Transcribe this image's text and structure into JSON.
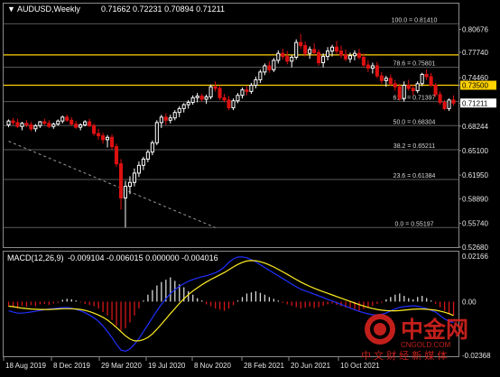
{
  "chart_data": [
    {
      "type": "candlestick",
      "title": "AUDUSD,Weekly",
      "ohlc_label": "0.71662 0.72231 0.70894 0.71211",
      "ylim": [
        0.5268,
        0.84
      ],
      "y_ticks": [
        "0.80676",
        "0.77740",
        "0.74460",
        "0.73500",
        "0.71211",
        "0.68244",
        "0.65100",
        "0.61950",
        "0.58890",
        "0.55740",
        "0.52680"
      ],
      "x_labels": [
        "18 Aug 2019",
        "8 Dec 2019",
        "29 Mar 2020",
        "19 Jul 2020",
        "8 Nov 2020",
        "28 Feb 2021",
        "20 Jun 2021",
        "10 Oct 2021"
      ],
      "fib_levels": [
        {
          "label": "100.0 = 0.81410",
          "value": 0.8141
        },
        {
          "label": "78.6 = 0.75801",
          "value": 0.75801
        },
        {
          "label": "61.8 = 0.71397",
          "value": 0.71397
        },
        {
          "label": "50.0 = 0.68304",
          "value": 0.68304
        },
        {
          "label": "38.2 = 0.65211",
          "value": 0.65211
        },
        {
          "label": "23.6 = 0.61384",
          "value": 0.61384
        },
        {
          "label": "0.0 = 0.55197",
          "value": 0.55197
        }
      ],
      "horizontal_lines": [
        {
          "value": 0.774,
          "label": "0.77400"
        },
        {
          "value": 0.735,
          "label": "0.73500"
        }
      ],
      "current_price": {
        "value": 0.71211,
        "label": "0.71211"
      },
      "candles": [
        [
          0.684,
          0.691,
          0.681,
          0.689
        ],
        [
          0.689,
          0.693,
          0.684,
          0.687
        ],
        [
          0.687,
          0.692,
          0.68,
          0.682
        ],
        [
          0.682,
          0.688,
          0.677,
          0.686
        ],
        [
          0.686,
          0.69,
          0.681,
          0.684
        ],
        [
          0.684,
          0.688,
          0.676,
          0.679
        ],
        [
          0.679,
          0.685,
          0.675,
          0.683
        ],
        [
          0.683,
          0.689,
          0.68,
          0.688
        ],
        [
          0.688,
          0.692,
          0.684,
          0.686
        ],
        [
          0.686,
          0.69,
          0.68,
          0.682
        ],
        [
          0.682,
          0.687,
          0.679,
          0.685
        ],
        [
          0.685,
          0.691,
          0.683,
          0.689
        ],
        [
          0.689,
          0.696,
          0.686,
          0.694
        ],
        [
          0.694,
          0.697,
          0.688,
          0.69
        ],
        [
          0.69,
          0.694,
          0.683,
          0.685
        ],
        [
          0.685,
          0.689,
          0.679,
          0.681
        ],
        [
          0.681,
          0.686,
          0.677,
          0.684
        ],
        [
          0.684,
          0.69,
          0.682,
          0.688
        ],
        [
          0.688,
          0.692,
          0.681,
          0.683
        ],
        [
          0.683,
          0.686,
          0.67,
          0.673
        ],
        [
          0.673,
          0.679,
          0.665,
          0.67
        ],
        [
          0.67,
          0.674,
          0.66,
          0.665
        ],
        [
          0.665,
          0.671,
          0.655,
          0.668
        ],
        [
          0.668,
          0.672,
          0.652,
          0.656
        ],
        [
          0.656,
          0.66,
          0.63,
          0.634
        ],
        [
          0.634,
          0.64,
          0.575,
          0.59
        ],
        [
          0.59,
          0.612,
          0.552,
          0.605
        ],
        [
          0.605,
          0.618,
          0.595,
          0.61
        ],
        [
          0.61,
          0.628,
          0.605,
          0.622
        ],
        [
          0.622,
          0.637,
          0.617,
          0.632
        ],
        [
          0.632,
          0.643,
          0.626,
          0.64
        ],
        [
          0.64,
          0.652,
          0.636,
          0.649
        ],
        [
          0.649,
          0.664,
          0.645,
          0.661
        ],
        [
          0.661,
          0.69,
          0.658,
          0.687
        ],
        [
          0.687,
          0.697,
          0.68,
          0.694
        ],
        [
          0.694,
          0.699,
          0.684,
          0.69
        ],
        [
          0.69,
          0.697,
          0.686,
          0.693
        ],
        [
          0.693,
          0.703,
          0.69,
          0.7
        ],
        [
          0.7,
          0.708,
          0.694,
          0.705
        ],
        [
          0.705,
          0.712,
          0.7,
          0.71
        ],
        [
          0.71,
          0.716,
          0.705,
          0.713
        ],
        [
          0.713,
          0.722,
          0.71,
          0.719
        ],
        [
          0.719,
          0.725,
          0.713,
          0.721
        ],
        [
          0.721,
          0.724,
          0.714,
          0.717
        ],
        [
          0.717,
          0.723,
          0.711,
          0.72
        ],
        [
          0.72,
          0.736,
          0.717,
          0.733
        ],
        [
          0.733,
          0.74,
          0.727,
          0.731
        ],
        [
          0.731,
          0.735,
          0.716,
          0.719
        ],
        [
          0.719,
          0.724,
          0.713,
          0.716
        ],
        [
          0.716,
          0.721,
          0.703,
          0.706
        ],
        [
          0.706,
          0.718,
          0.703,
          0.715
        ],
        [
          0.715,
          0.725,
          0.712,
          0.722
        ],
        [
          0.722,
          0.732,
          0.718,
          0.729
        ],
        [
          0.729,
          0.734,
          0.722,
          0.727
        ],
        [
          0.727,
          0.738,
          0.724,
          0.735
        ],
        [
          0.735,
          0.746,
          0.731,
          0.742
        ],
        [
          0.742,
          0.755,
          0.738,
          0.752
        ],
        [
          0.752,
          0.763,
          0.748,
          0.76
        ],
        [
          0.76,
          0.766,
          0.751,
          0.755
        ],
        [
          0.755,
          0.77,
          0.752,
          0.767
        ],
        [
          0.767,
          0.78,
          0.763,
          0.776
        ],
        [
          0.776,
          0.782,
          0.768,
          0.772
        ],
        [
          0.772,
          0.779,
          0.762,
          0.766
        ],
        [
          0.766,
          0.774,
          0.758,
          0.771
        ],
        [
          0.771,
          0.794,
          0.768,
          0.79
        ],
        [
          0.79,
          0.801,
          0.782,
          0.786
        ],
        [
          0.786,
          0.791,
          0.772,
          0.776
        ],
        [
          0.776,
          0.785,
          0.769,
          0.781
        ],
        [
          0.781,
          0.789,
          0.774,
          0.777
        ],
        [
          0.777,
          0.781,
          0.76,
          0.764
        ],
        [
          0.764,
          0.776,
          0.758,
          0.772
        ],
        [
          0.772,
          0.784,
          0.767,
          0.779
        ],
        [
          0.779,
          0.787,
          0.772,
          0.784
        ],
        [
          0.784,
          0.792,
          0.775,
          0.779
        ],
        [
          0.779,
          0.786,
          0.77,
          0.774
        ],
        [
          0.774,
          0.781,
          0.766,
          0.769
        ],
        [
          0.769,
          0.777,
          0.764,
          0.773
        ],
        [
          0.773,
          0.78,
          0.767,
          0.776
        ],
        [
          0.776,
          0.782,
          0.768,
          0.771
        ],
        [
          0.771,
          0.776,
          0.758,
          0.761
        ],
        [
          0.761,
          0.767,
          0.752,
          0.757
        ],
        [
          0.757,
          0.764,
          0.75,
          0.76
        ],
        [
          0.76,
          0.765,
          0.744,
          0.747
        ],
        [
          0.747,
          0.752,
          0.737,
          0.741
        ],
        [
          0.741,
          0.747,
          0.733,
          0.744
        ],
        [
          0.744,
          0.749,
          0.734,
          0.737
        ],
        [
          0.737,
          0.742,
          0.728,
          0.733
        ],
        [
          0.733,
          0.737,
          0.715,
          0.718
        ],
        [
          0.718,
          0.74,
          0.714,
          0.735
        ],
        [
          0.735,
          0.742,
          0.728,
          0.731
        ],
        [
          0.731,
          0.736,
          0.722,
          0.728
        ],
        [
          0.728,
          0.74,
          0.725,
          0.737
        ],
        [
          0.737,
          0.751,
          0.734,
          0.749
        ],
        [
          0.749,
          0.755,
          0.742,
          0.746
        ],
        [
          0.746,
          0.751,
          0.733,
          0.735
        ],
        [
          0.735,
          0.738,
          0.72,
          0.723
        ],
        [
          0.723,
          0.727,
          0.71,
          0.713
        ],
        [
          0.713,
          0.716,
          0.703,
          0.705
        ],
        [
          0.705,
          0.718,
          0.702,
          0.716
        ],
        [
          0.716,
          0.722,
          0.709,
          0.712
        ]
      ],
      "trend_line": [
        [
          0,
          0.663
        ],
        [
          46,
          0.552
        ]
      ]
    },
    {
      "type": "macd",
      "title": "MACD(12,26,9)",
      "values_label": "-0.009104 -0.006015 0.000000 -0.004016",
      "ylim": [
        -0.02368,
        0.02166
      ],
      "y_ticks": [
        "0.02166",
        "0.00",
        "-0.02368"
      ],
      "histogram": [
        -0.002,
        -0.0025,
        -0.003,
        -0.0018,
        -0.0022,
        -0.0015,
        -0.002,
        -0.0012,
        -0.001,
        -0.0014,
        -0.0008,
        -0.0005,
        0.0008,
        0.0012,
        0.001,
        0.0005,
        -0.0004,
        -0.001,
        -0.0015,
        -0.002,
        -0.003,
        -0.0045,
        -0.006,
        -0.008,
        -0.0105,
        -0.0125,
        -0.0115,
        -0.009,
        -0.006,
        -0.003,
        0.0005,
        0.003,
        0.005,
        0.007,
        0.0085,
        0.0095,
        0.0105,
        0.009,
        0.0075,
        0.0062,
        0.0045,
        0.003,
        0.0015,
        0.0005,
        -0.0012,
        -0.002,
        -0.003,
        -0.0035,
        -0.004,
        -0.003,
        -0.0015,
        0.0005,
        0.002,
        0.0035,
        0.004,
        0.0045,
        0.0038,
        0.003,
        0.002,
        0.0012,
        0.0005,
        -0.0005,
        -0.0012,
        -0.0018,
        -0.0024,
        -0.003,
        -0.0026,
        -0.0022,
        -0.0028,
        -0.0024,
        -0.0018,
        -0.0012,
        -0.0008,
        -0.0014,
        -0.002,
        -0.0026,
        -0.003,
        -0.0035,
        -0.004,
        -0.0032,
        -0.0025,
        -0.0018,
        -0.001,
        -0.0005,
        0.001,
        0.002,
        0.003,
        0.0035,
        0.0025,
        0.0015,
        0.001,
        0.002,
        0.0025,
        0.0015,
        0.0005,
        -0.001,
        -0.0025,
        -0.004,
        -0.0055,
        -0.006
      ],
      "macd_line": [
        -0.004,
        -0.0045,
        -0.005,
        -0.005,
        -0.0048,
        -0.0045,
        -0.0042,
        -0.0038,
        -0.0035,
        -0.0032,
        -0.003,
        -0.0028,
        -0.0026,
        -0.0025,
        -0.0028,
        -0.0034,
        -0.004,
        -0.0048,
        -0.0058,
        -0.007,
        -0.0085,
        -0.0105,
        -0.013,
        -0.0155,
        -0.0185,
        -0.021,
        -0.0215,
        -0.0205,
        -0.0185,
        -0.016,
        -0.013,
        -0.01,
        -0.007,
        -0.004,
        -0.0012,
        0.0012,
        0.0035,
        0.0052,
        0.0066,
        0.0078,
        0.0088,
        0.0096,
        0.0102,
        0.0108,
        0.0112,
        0.0118,
        0.0125,
        0.0135,
        0.015,
        0.017,
        0.0185,
        0.0193,
        0.0194,
        0.019,
        0.0182,
        0.0172,
        0.016,
        0.0148,
        0.0136,
        0.0124,
        0.0112,
        0.01,
        0.0088,
        0.0076,
        0.0064,
        0.0054,
        0.0046,
        0.004,
        0.0032,
        0.0025,
        0.0018,
        0.001,
        0.0003,
        -0.0005,
        -0.0012,
        -0.002,
        -0.0028,
        -0.0035,
        -0.0042,
        -0.0048,
        -0.0053,
        -0.0057,
        -0.0058,
        -0.0055,
        -0.005,
        -0.004,
        -0.0032,
        -0.0025,
        -0.0022,
        -0.002,
        -0.0018,
        -0.002,
        -0.0025,
        -0.003,
        -0.0038,
        -0.0045,
        -0.006,
        -0.0075,
        -0.0085,
        -0.0091
      ],
      "signal_line": [
        -0.002,
        -0.0022,
        -0.0025,
        -0.0028,
        -0.003,
        -0.0032,
        -0.0033,
        -0.0034,
        -0.0034,
        -0.0034,
        -0.0033,
        -0.0032,
        -0.0031,
        -0.0031,
        -0.0031,
        -0.0032,
        -0.0034,
        -0.0038,
        -0.0043,
        -0.005,
        -0.0058,
        -0.0068,
        -0.008,
        -0.0095,
        -0.0112,
        -0.013,
        -0.0148,
        -0.0162,
        -0.017,
        -0.017,
        -0.0165,
        -0.0155,
        -0.014,
        -0.012,
        -0.0098,
        -0.0075,
        -0.0052,
        -0.003,
        -0.0008,
        0.0012,
        0.003,
        0.0046,
        0.006,
        0.0073,
        0.0085,
        0.0096,
        0.0106,
        0.0116,
        0.0126,
        0.0138,
        0.015,
        0.0161,
        0.017,
        0.0176,
        0.0178,
        0.0177,
        0.0173,
        0.0167,
        0.0159,
        0.015,
        0.014,
        0.0129,
        0.0118,
        0.0107,
        0.0096,
        0.0085,
        0.0075,
        0.0066,
        0.0058,
        0.005,
        0.0043,
        0.0036,
        0.0029,
        0.0022,
        0.0015,
        0.0008,
        0.0001,
        -0.0006,
        -0.0013,
        -0.0019,
        -0.0025,
        -0.003,
        -0.0034,
        -0.0037,
        -0.0039,
        -0.004,
        -0.004,
        -0.0039,
        -0.0037,
        -0.0035,
        -0.0033,
        -0.0032,
        -0.0032,
        -0.0033,
        -0.0035,
        -0.0037,
        -0.0041,
        -0.0046,
        -0.0052,
        -0.006
      ]
    }
  ],
  "watermark": {
    "name": "中金网",
    "domain": "CNGOLD.COM",
    "slogan": "中 文 财 经 新 媒 体"
  },
  "colors": {
    "background": "#000000",
    "bull_candle": "#ffffff",
    "bear_candle": "#dd1010",
    "level_line": "#ffd200",
    "fib_line": "#5a5a5a",
    "macd_line": "#2030ff",
    "signal_line": "#ffee22",
    "macd_hist_positive": "#d8d8d8",
    "macd_hist_negative": "#d41616",
    "axis_text": "#e6e6e6",
    "watermark_red": "#d8231f"
  }
}
